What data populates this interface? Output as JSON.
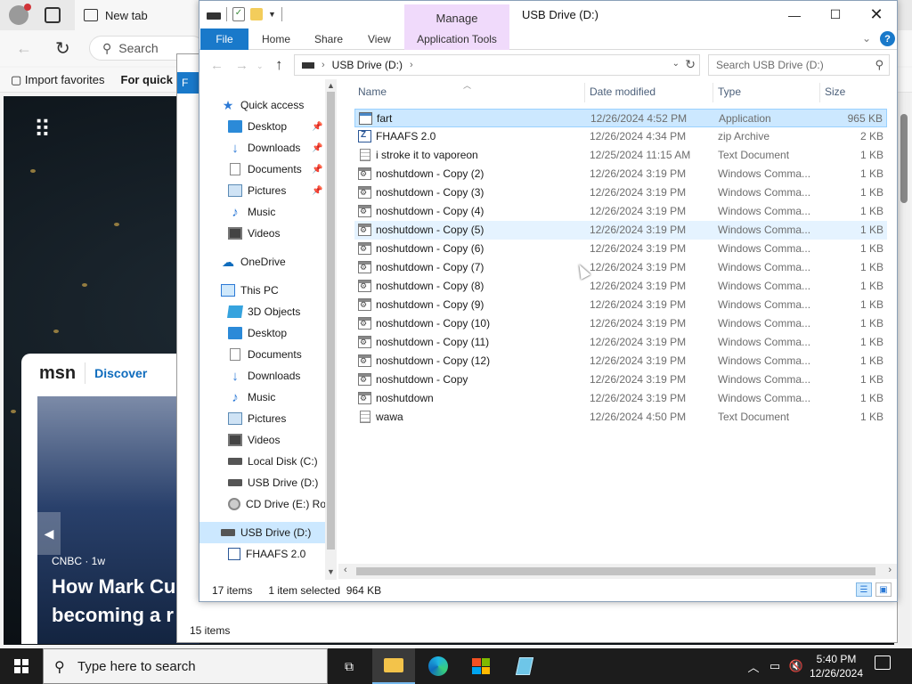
{
  "browser": {
    "tab_title": "New tab",
    "search_placeholder": "Search",
    "favorites": [
      "Import favorites",
      "For quick"
    ],
    "msn_logo": "msn",
    "msn_discover": "Discover",
    "story_source": "CNBC · 1w",
    "story_headline_1": "How Mark Cu",
    "story_headline_2": "becoming a r"
  },
  "bg_window": {
    "file_tab": "F",
    "status": "15 items"
  },
  "window": {
    "title": "USB Drive (D:)",
    "manage_tab": "Manage",
    "ribbon_tabs": [
      "File",
      "Home",
      "Share",
      "View",
      "Application Tools"
    ],
    "address_path": "USB Drive (D:)",
    "search_placeholder": "Search USB Drive (D:)"
  },
  "nav": {
    "items": [
      {
        "label": "Quick access",
        "icon": "star-icon"
      },
      {
        "label": "Desktop",
        "icon": "desktop-icon",
        "pinned": true
      },
      {
        "label": "Downloads",
        "icon": "download-icon",
        "pinned": true
      },
      {
        "label": "Documents",
        "icon": "documents-icon",
        "pinned": true
      },
      {
        "label": "Pictures",
        "icon": "pictures-icon",
        "pinned": true
      },
      {
        "label": "Music",
        "icon": "music-icon"
      },
      {
        "label": "Videos",
        "icon": "videos-icon"
      },
      {
        "label": "OneDrive",
        "icon": "cloud-icon"
      },
      {
        "label": "This PC",
        "icon": "computer-icon"
      },
      {
        "label": "3D Objects",
        "icon": "cube-icon"
      },
      {
        "label": "Desktop",
        "icon": "desktop-icon"
      },
      {
        "label": "Documents",
        "icon": "documents-icon"
      },
      {
        "label": "Downloads",
        "icon": "download-icon"
      },
      {
        "label": "Music",
        "icon": "music-icon"
      },
      {
        "label": "Pictures",
        "icon": "pictures-icon"
      },
      {
        "label": "Videos",
        "icon": "videos-icon"
      },
      {
        "label": "Local Disk (C:)",
        "icon": "disk-icon"
      },
      {
        "label": "USB Drive (D:)",
        "icon": "usb-drive-icon"
      },
      {
        "label": "CD Drive (E:) Roc",
        "icon": "cd-drive-icon"
      },
      {
        "label": "USB Drive (D:)",
        "icon": "usb-drive-icon",
        "selected": true
      },
      {
        "label": "FHAAFS 2.0",
        "icon": "zip-icon"
      }
    ]
  },
  "columns": {
    "name": "Name",
    "date": "Date modified",
    "type": "Type",
    "size": "Size"
  },
  "files": [
    {
      "name": "fart",
      "date": "12/26/2024 4:52 PM",
      "type": "Application",
      "size": "965 KB",
      "icon": "application-icon",
      "state": "selected"
    },
    {
      "name": "FHAAFS 2.0",
      "date": "12/26/2024 4:34 PM",
      "type": "zip Archive",
      "size": "2 KB",
      "icon": "zip-archive-icon"
    },
    {
      "name": "i stroke it to vaporeon",
      "date": "12/25/2024 11:15 AM",
      "type": "Text Document",
      "size": "1 KB",
      "icon": "text-document-icon"
    },
    {
      "name": "noshutdown - Copy (2)",
      "date": "12/26/2024 3:19 PM",
      "type": "Windows Comma...",
      "size": "1 KB",
      "icon": "batch-file-icon"
    },
    {
      "name": "noshutdown - Copy (3)",
      "date": "12/26/2024 3:19 PM",
      "type": "Windows Comma...",
      "size": "1 KB",
      "icon": "batch-file-icon"
    },
    {
      "name": "noshutdown - Copy (4)",
      "date": "12/26/2024 3:19 PM",
      "type": "Windows Comma...",
      "size": "1 KB",
      "icon": "batch-file-icon"
    },
    {
      "name": "noshutdown - Copy (5)",
      "date": "12/26/2024 3:19 PM",
      "type": "Windows Comma...",
      "size": "1 KB",
      "icon": "batch-file-icon",
      "state": "hover"
    },
    {
      "name": "noshutdown - Copy (6)",
      "date": "12/26/2024 3:19 PM",
      "type": "Windows Comma...",
      "size": "1 KB",
      "icon": "batch-file-icon"
    },
    {
      "name": "noshutdown - Copy (7)",
      "date": "12/26/2024 3:19 PM",
      "type": "Windows Comma...",
      "size": "1 KB",
      "icon": "batch-file-icon"
    },
    {
      "name": "noshutdown - Copy (8)",
      "date": "12/26/2024 3:19 PM",
      "type": "Windows Comma...",
      "size": "1 KB",
      "icon": "batch-file-icon"
    },
    {
      "name": "noshutdown - Copy (9)",
      "date": "12/26/2024 3:19 PM",
      "type": "Windows Comma...",
      "size": "1 KB",
      "icon": "batch-file-icon"
    },
    {
      "name": "noshutdown - Copy (10)",
      "date": "12/26/2024 3:19 PM",
      "type": "Windows Comma...",
      "size": "1 KB",
      "icon": "batch-file-icon"
    },
    {
      "name": "noshutdown - Copy (11)",
      "date": "12/26/2024 3:19 PM",
      "type": "Windows Comma...",
      "size": "1 KB",
      "icon": "batch-file-icon"
    },
    {
      "name": "noshutdown - Copy (12)",
      "date": "12/26/2024 3:19 PM",
      "type": "Windows Comma...",
      "size": "1 KB",
      "icon": "batch-file-icon"
    },
    {
      "name": "noshutdown - Copy",
      "date": "12/26/2024 3:19 PM",
      "type": "Windows Comma...",
      "size": "1 KB",
      "icon": "batch-file-icon"
    },
    {
      "name": "noshutdown",
      "date": "12/26/2024 3:19 PM",
      "type": "Windows Comma...",
      "size": "1 KB",
      "icon": "batch-file-icon"
    },
    {
      "name": "wawa",
      "date": "12/26/2024 4:50 PM",
      "type": "Text Document",
      "size": "1 KB",
      "icon": "text-document-icon"
    }
  ],
  "status": {
    "count": "17 items",
    "selection": "1 item selected  964 KB"
  },
  "taskbar": {
    "search_placeholder": "Type here to search",
    "time": "5:40 PM",
    "date": "12/26/2024"
  }
}
